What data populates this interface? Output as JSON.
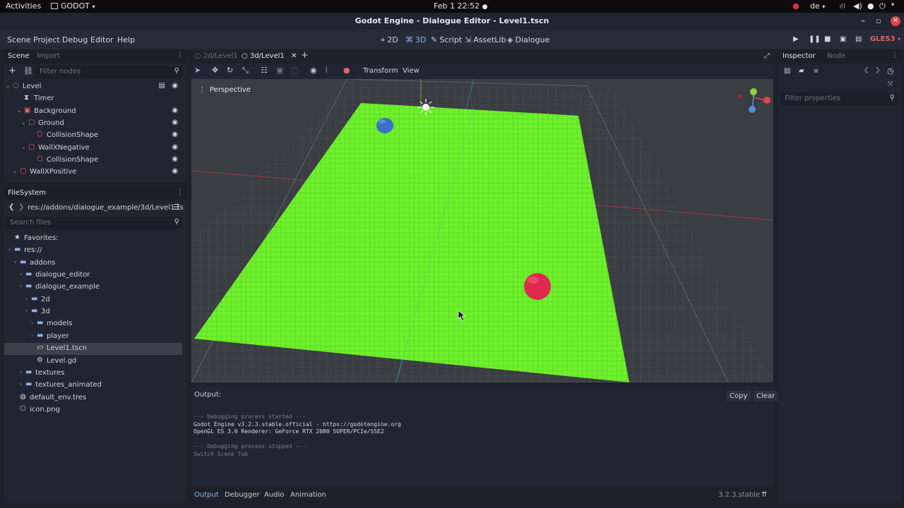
{
  "gnome": {
    "activities": "Activities",
    "app_name": "GODOT",
    "clock": "Feb 1  22:52",
    "lang": "de"
  },
  "window": {
    "title": "Godot Engine - Dialogue Editor - Level1.tscn"
  },
  "menubar": {
    "menus": [
      "Scene",
      "Project",
      "Debug",
      "Editor",
      "Help"
    ],
    "workspaces": [
      "2D",
      "3D",
      "Script",
      "AssetLib",
      "Dialogue"
    ],
    "active_workspace": "3D",
    "renderer": "GLES3"
  },
  "scene_dock": {
    "tabs": [
      "Scene",
      "Import"
    ],
    "filter_placeholder": "Filter nodes",
    "nodes": [
      {
        "name": "Level",
        "depth": 0,
        "icon": "node3d-icon"
      },
      {
        "name": "Timer",
        "depth": 1,
        "icon": "timer-icon"
      },
      {
        "name": "Background",
        "depth": 1,
        "icon": "mesh-icon"
      },
      {
        "name": "Ground",
        "depth": 2,
        "icon": "staticbody-icon"
      },
      {
        "name": "CollisionShape",
        "depth": 3,
        "icon": "collision-icon"
      },
      {
        "name": "WallXNegative",
        "depth": 2,
        "icon": "staticbody-icon"
      },
      {
        "name": "CollisionShape",
        "depth": 3,
        "icon": "collision-icon"
      },
      {
        "name": "WallXPositive",
        "depth": 2,
        "icon": "staticbody-icon"
      }
    ]
  },
  "filesystem_dock": {
    "tab": "FileSystem",
    "path": "res://addons/dialogue_example/3d/Level1.ts",
    "search_placeholder": "Search files",
    "items": [
      {
        "name": "Favorites:",
        "depth": 0,
        "icon": "star-icon"
      },
      {
        "name": "res://",
        "depth": 0,
        "icon": "folder-icon"
      },
      {
        "name": "addons",
        "depth": 1,
        "icon": "folder-icon"
      },
      {
        "name": "dialogue_editor",
        "depth": 2,
        "icon": "folder-icon"
      },
      {
        "name": "dialogue_example",
        "depth": 2,
        "icon": "folder-icon"
      },
      {
        "name": "2d",
        "depth": 3,
        "icon": "folder-icon"
      },
      {
        "name": "3d",
        "depth": 3,
        "icon": "folder-icon"
      },
      {
        "name": "models",
        "depth": 4,
        "icon": "folder-icon"
      },
      {
        "name": "player",
        "depth": 4,
        "icon": "folder-icon"
      },
      {
        "name": "Level1.tscn",
        "depth": 4,
        "icon": "scene-icon"
      },
      {
        "name": "Level.gd",
        "depth": 4,
        "icon": "script-icon"
      },
      {
        "name": "textures",
        "depth": 2,
        "icon": "folder-icon"
      },
      {
        "name": "textures_animated",
        "depth": 2,
        "icon": "folder-icon"
      },
      {
        "name": "default_env.tres",
        "depth": 1,
        "icon": "env-icon"
      },
      {
        "name": "icon.png",
        "depth": 1,
        "icon": "image-icon"
      }
    ],
    "selected": "Level1.tscn"
  },
  "editor": {
    "tabs": [
      "2d/Level1",
      "3d/Level1"
    ],
    "active_tab": "3d/Level1",
    "toolbar": {
      "transform": "Transform",
      "view": "View"
    },
    "viewport_label": "Perspective"
  },
  "output": {
    "title": "Output:",
    "copy": "Copy",
    "clear": "Clear",
    "lines": [
      {
        "text": "--- Debugging process started ---",
        "dim": true
      },
      {
        "text": "Godot Engine v3.2.3.stable.official - https://godotengine.org",
        "dim": false
      },
      {
        "text": "OpenGL ES 3.0 Renderer: GeForce RTX 2080 SUPER/PCIe/SSE2",
        "dim": false
      },
      {
        "text": "",
        "dim": false
      },
      {
        "text": "--- Debugging process stopped ---",
        "dim": true
      },
      {
        "text": "Switch Scene Tab",
        "dim": true
      }
    ]
  },
  "bottom_bar": {
    "tabs": [
      "Output",
      "Debugger",
      "Audio",
      "Animation"
    ],
    "active": "Output",
    "version": "3.2.3.stable"
  },
  "inspector": {
    "tabs": [
      "Inspector",
      "Node"
    ],
    "filter_placeholder": "Filter properties"
  },
  "colors": {
    "accent": "#8fb3e8",
    "ground": "#6ff030",
    "player": "#3d6fc4",
    "npc": "#e0294f"
  }
}
